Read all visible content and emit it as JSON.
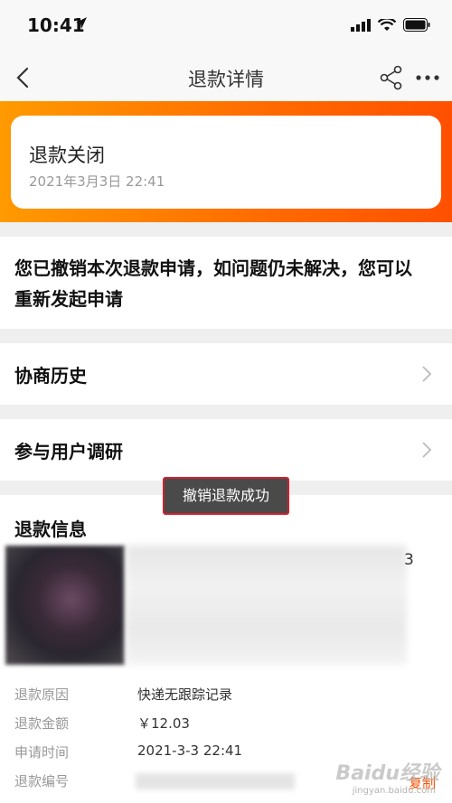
{
  "status_bar": {
    "time": "10:41"
  },
  "nav": {
    "title": "退款详情"
  },
  "status_card": {
    "title": "退款关闭",
    "date": "2021年3月3日 22:41"
  },
  "message": {
    "text": "您已撤销本次退款申请，如问题仍未解决，您可以重新发起申请"
  },
  "rows": {
    "history_label": "协商历史",
    "survey_label": "参与用户调研"
  },
  "toast": {
    "text": "撤销退款成功"
  },
  "refund_info": {
    "title": "退款信息",
    "partial_char": "3",
    "reason_label": "退款原因",
    "reason_value": "快递无跟踪记录",
    "amount_label": "退款金额",
    "amount_value": "￥12.03",
    "time_label": "申请时间",
    "time_value": "2021-3-3 22:41",
    "id_label": "退款编号",
    "copy_label": "复制"
  },
  "watermark": {
    "brand": "Baidu经验",
    "url": "jingyan.baidu.com"
  },
  "colors": {
    "accent": "#ff5000",
    "banner_start": "#ff9a00",
    "banner_end": "#ff5000"
  }
}
